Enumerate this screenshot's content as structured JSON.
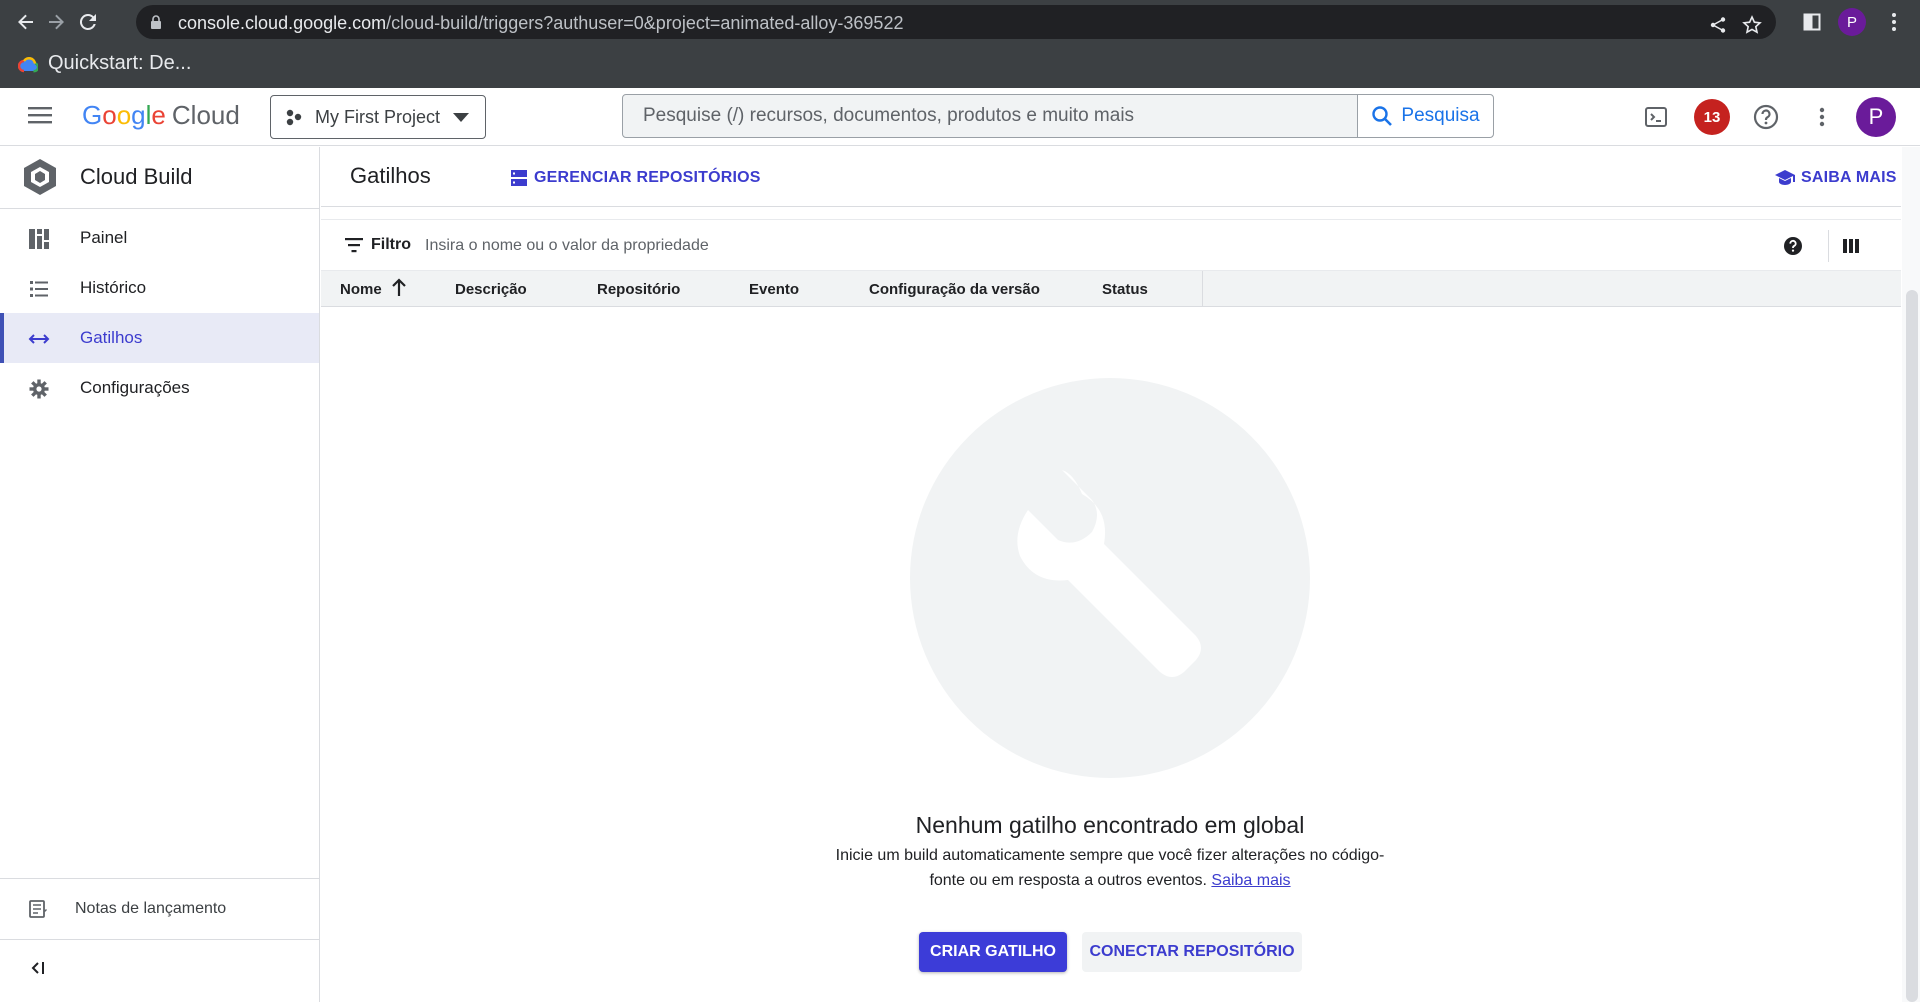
{
  "browser": {
    "url_host": "console.cloud.google.com",
    "url_path": "/cloud-build/triggers?authuser=0&project=animated-alloy-369522",
    "profile_initial": "P",
    "bookmark_label": "Quickstart: De..."
  },
  "appbar": {
    "logo_google": [
      "G",
      "o",
      "o",
      "g",
      "l",
      "e"
    ],
    "logo_cloud": "Cloud",
    "project_name": "My First Project",
    "search_placeholder": "Pesquise (/) recursos, documentos, produtos e muito mais",
    "search_button": "Pesquisa",
    "notification_count": "13",
    "avatar_initial": "P"
  },
  "sidebar": {
    "product_name": "Cloud Build",
    "items": [
      {
        "label": "Painel",
        "icon": "dashboard-icon"
      },
      {
        "label": "Histórico",
        "icon": "list-icon"
      },
      {
        "label": "Gatilhos",
        "icon": "arrows-icon",
        "active": true
      },
      {
        "label": "Configurações",
        "icon": "gear-icon"
      }
    ],
    "release_notes": "Notas de lançamento"
  },
  "page": {
    "title": "Gatilhos",
    "manage_repos": "GERENCIAR REPOSITÓRIOS",
    "learn_more": "SAIBA MAIS"
  },
  "filter": {
    "label": "Filtro",
    "placeholder": "Insira o nome ou o valor da propriedade"
  },
  "table": {
    "columns": [
      "Nome",
      "Descrição",
      "Repositório",
      "Evento",
      "Configuração da versão",
      "Status"
    ]
  },
  "empty_state": {
    "title": "Nenhum gatilho encontrado em global",
    "description": "Inicie um build automaticamente sempre que você fizer alterações no código-fonte ou em resposta a outros eventos.",
    "learn_more_link": "Saiba mais",
    "primary_button": "CRIAR GATILHO",
    "secondary_button": "CONECTAR REPOSITÓRIO"
  },
  "colors": {
    "accent": "#3c3cd8",
    "active_nav_bg": "#e8eaf6",
    "notification": "#c5221f",
    "avatar": "#6a1b9a"
  }
}
